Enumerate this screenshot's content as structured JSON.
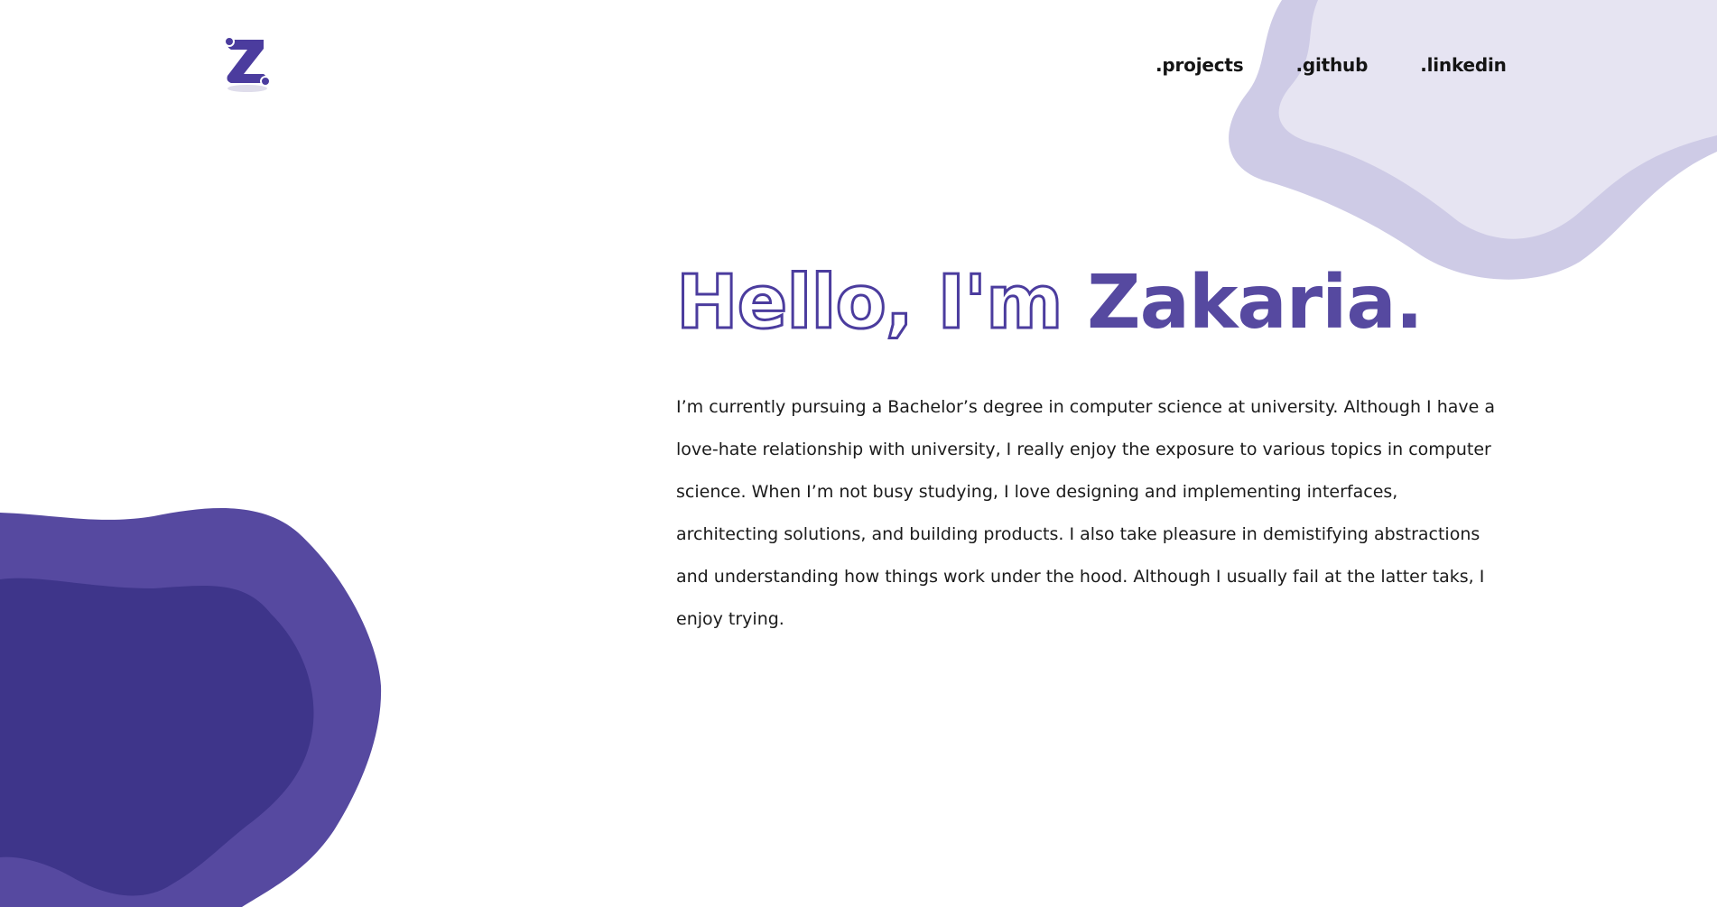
{
  "colors": {
    "accent": "#5649a0",
    "accent_dark": "#3e358a",
    "blob_light": "#e6e4f2",
    "blob_medium": "#cecbe6",
    "text": "#1b1b1b"
  },
  "logo": {
    "letter": "Z",
    "icon": "z-logo-icon"
  },
  "nav": {
    "items": [
      {
        "label": ".projects"
      },
      {
        "label": ".github"
      },
      {
        "label": ".linkedin"
      }
    ]
  },
  "hero": {
    "greeting": "Hello, I'm ",
    "name": "Zakaria.",
    "bio": "I’m currently pursuing a Bachelor’s degree in computer science at university. Although I have a love-hate relationship with university, I really enjoy the exposure to various topics in computer science. When I’m not busy studying, I love designing and implementing interfaces, architecting solutions, and building products. I also take pleasure in demistifying abstractions and understanding how things work under the hood. Although I usually fail at the latter taks, I enjoy trying."
  }
}
